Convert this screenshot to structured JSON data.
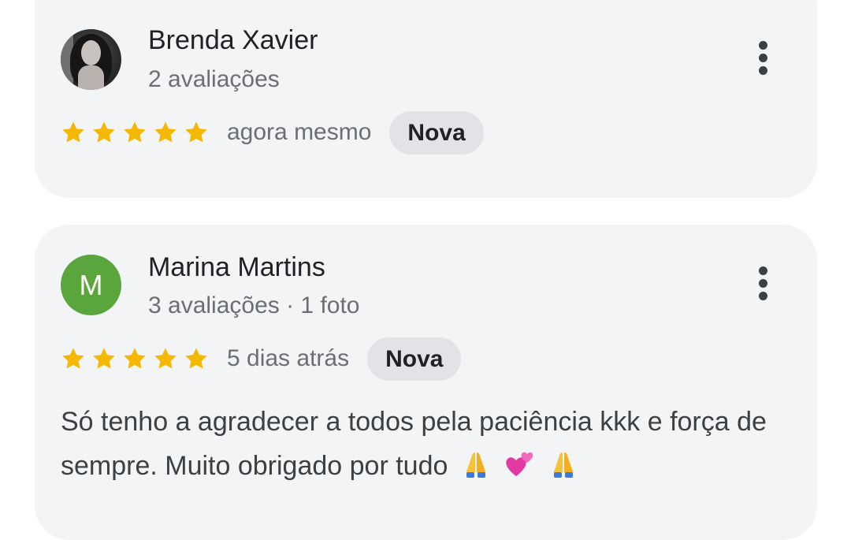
{
  "reviews": [
    {
      "author": "Brenda Xavier",
      "meta": "2 avaliações",
      "avatar_type": "photo",
      "stars": 5,
      "time": "agora mesmo",
      "badge": "Nova",
      "text": ""
    },
    {
      "author": "Marina Martins",
      "meta": "3 avaliações · 1 foto",
      "avatar_type": "letter",
      "avatar_letter": "M",
      "avatar_color": "#5aa63c",
      "stars": 5,
      "time": "5 dias atrás",
      "badge": "Nova",
      "text": "Só tenho a agradecer a todos pela paciência kkk e força de sempre. Muito obrigado por tudo",
      "text_emojis": [
        "folded-hands-emoji",
        "two-hearts-emoji",
        "folded-hands-emoji"
      ]
    }
  ],
  "colors": {
    "star": "#f5b800",
    "card_bg": "#f3f4f6",
    "badge_bg": "#e1e3e6"
  },
  "icons": {
    "more_menu": "more-vert-icon",
    "star": "star-icon"
  }
}
